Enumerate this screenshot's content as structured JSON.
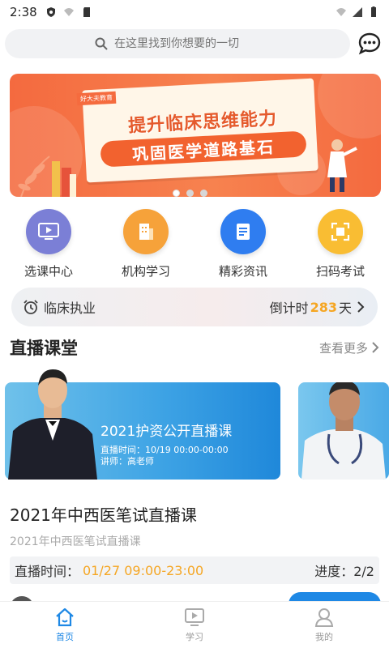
{
  "status_bar": {
    "time": "2:38"
  },
  "search": {
    "placeholder": "在这里找到你想要的一切"
  },
  "banner": {
    "tag": "好大夫教育",
    "line1": "提升临床思维能力",
    "line2": "巩固医学道路基石",
    "dot_count": 3,
    "active_dot": 0
  },
  "menu": [
    {
      "label": "选课中心",
      "icon": "play-screen-icon",
      "color": "#7b7fd6"
    },
    {
      "label": "机构学习",
      "icon": "building-icon",
      "color": "#f6a23a"
    },
    {
      "label": "精彩资讯",
      "icon": "news-icon",
      "color": "#2f7df0"
    },
    {
      "label": "扫码考试",
      "icon": "scan-icon",
      "color": "#f9bd33"
    }
  ],
  "exam": {
    "name": "临床执业",
    "countdown_prefix": "倒计时",
    "days": "283",
    "days_suffix": "天"
  },
  "live_section": {
    "title": "直播课堂",
    "more": "查看更多"
  },
  "live_card": {
    "title": "2021护资公开直播课",
    "time": "直播时间：10/19 00:00-00:00",
    "teacher": "讲师：高老师"
  },
  "course": {
    "title": "2021年中西医笔试直播课",
    "subtitle": "2021年中西医笔试直播课",
    "time_label": "直播时间：",
    "time_value": "01/27 09:00-23:00",
    "progress": "进度：2/2"
  },
  "bottom_nav": [
    {
      "label": "首页",
      "icon": "home-icon",
      "active": true
    },
    {
      "label": "学习",
      "icon": "play-screen-icon",
      "active": false
    },
    {
      "label": "我的",
      "icon": "user-icon",
      "active": false
    }
  ],
  "colors": {
    "accent": "#1e88e5",
    "highlight": "#f5a623",
    "banner": "#f46a3f"
  }
}
